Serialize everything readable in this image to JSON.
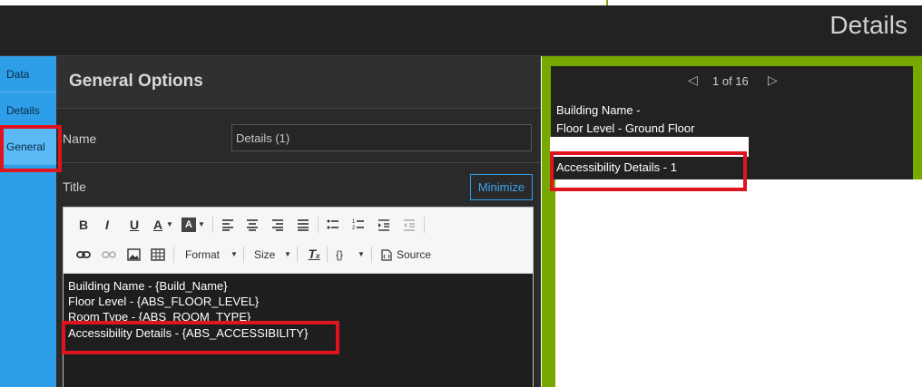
{
  "header": {
    "title": "Details"
  },
  "tabs": [
    {
      "label": "Data"
    },
    {
      "label": "Details"
    },
    {
      "label": "General"
    }
  ],
  "general": {
    "title": "General Options",
    "name_label": "Name",
    "name_value": "Details (1)",
    "title_label": "Title",
    "minimize_label": "Minimize"
  },
  "toolbar": {
    "bold": "B",
    "italic": "I",
    "underline": "U",
    "text_color": "A",
    "bg_color": "A",
    "format_label": "Format",
    "size_label": "Size",
    "source_label": "Source",
    "braces": "{}"
  },
  "editor": {
    "lines": [
      "Building Name - {Build_Name}",
      "Floor Level - {ABS_FLOOR_LEVEL}",
      "Room Type - {ABS_ROOM_TYPE}",
      "Accessibility Details - {ABS_ACCESSIBILITY}"
    ]
  },
  "popup": {
    "pager": "1 of 16",
    "lines": [
      "Building Name -",
      "Floor Level - Ground Floor",
      "Accessibility Details - 1"
    ]
  },
  "colors": {
    "accent": "#2f9ee8",
    "frame": "#76a800",
    "highlight": "#e0141e"
  },
  "icons": [
    "chevron-left-icon",
    "chevron-right-icon",
    "link-icon",
    "unlink-icon",
    "image-icon",
    "table-icon",
    "clear-format-icon",
    "source-icon"
  ]
}
